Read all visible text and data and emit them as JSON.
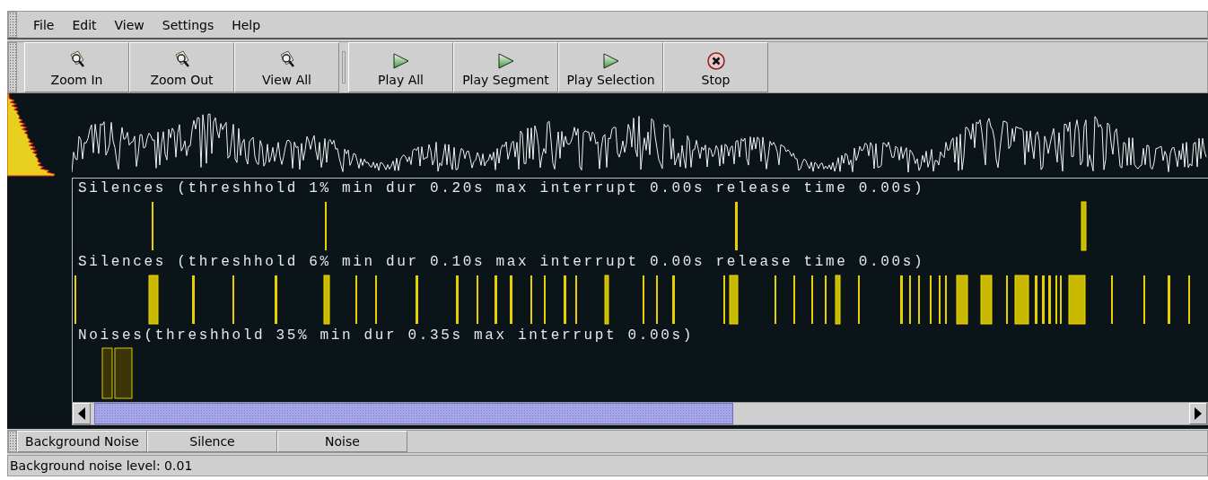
{
  "menu": [
    {
      "label": "File"
    },
    {
      "label": "Edit"
    },
    {
      "label": "View"
    },
    {
      "label": "Settings"
    },
    {
      "label": "Help"
    }
  ],
  "toolbar": [
    {
      "kind": "zoom",
      "label": "Zoom In"
    },
    {
      "kind": "zoom",
      "label": "Zoom Out"
    },
    {
      "kind": "zoom",
      "label": "View All"
    },
    {
      "kind": "separator"
    },
    {
      "kind": "play",
      "label": "Play All"
    },
    {
      "kind": "play",
      "label": "Play Segment"
    },
    {
      "kind": "play",
      "label": "Play Selection"
    },
    {
      "kind": "stop",
      "label": "Stop"
    }
  ],
  "tracks": [
    {
      "kind": "silence",
      "label": "Silences (threshhold 1% min dur 0.20s max interrupt 0.00s release time 0.00s)"
    },
    {
      "kind": "silence",
      "label": "Silences (threshhold 6% min dur 0.10s max interrupt 0.00s release time 0.00s)"
    },
    {
      "kind": "noise",
      "label": "Noises(threshhold 35% min dur 0.35s max interrupt 0.00s)"
    }
  ],
  "tabs": [
    {
      "label": "Background Noise"
    },
    {
      "label": "Silence"
    },
    {
      "label": "Noise"
    }
  ],
  "status_bar": "Background noise level: 0.01"
}
